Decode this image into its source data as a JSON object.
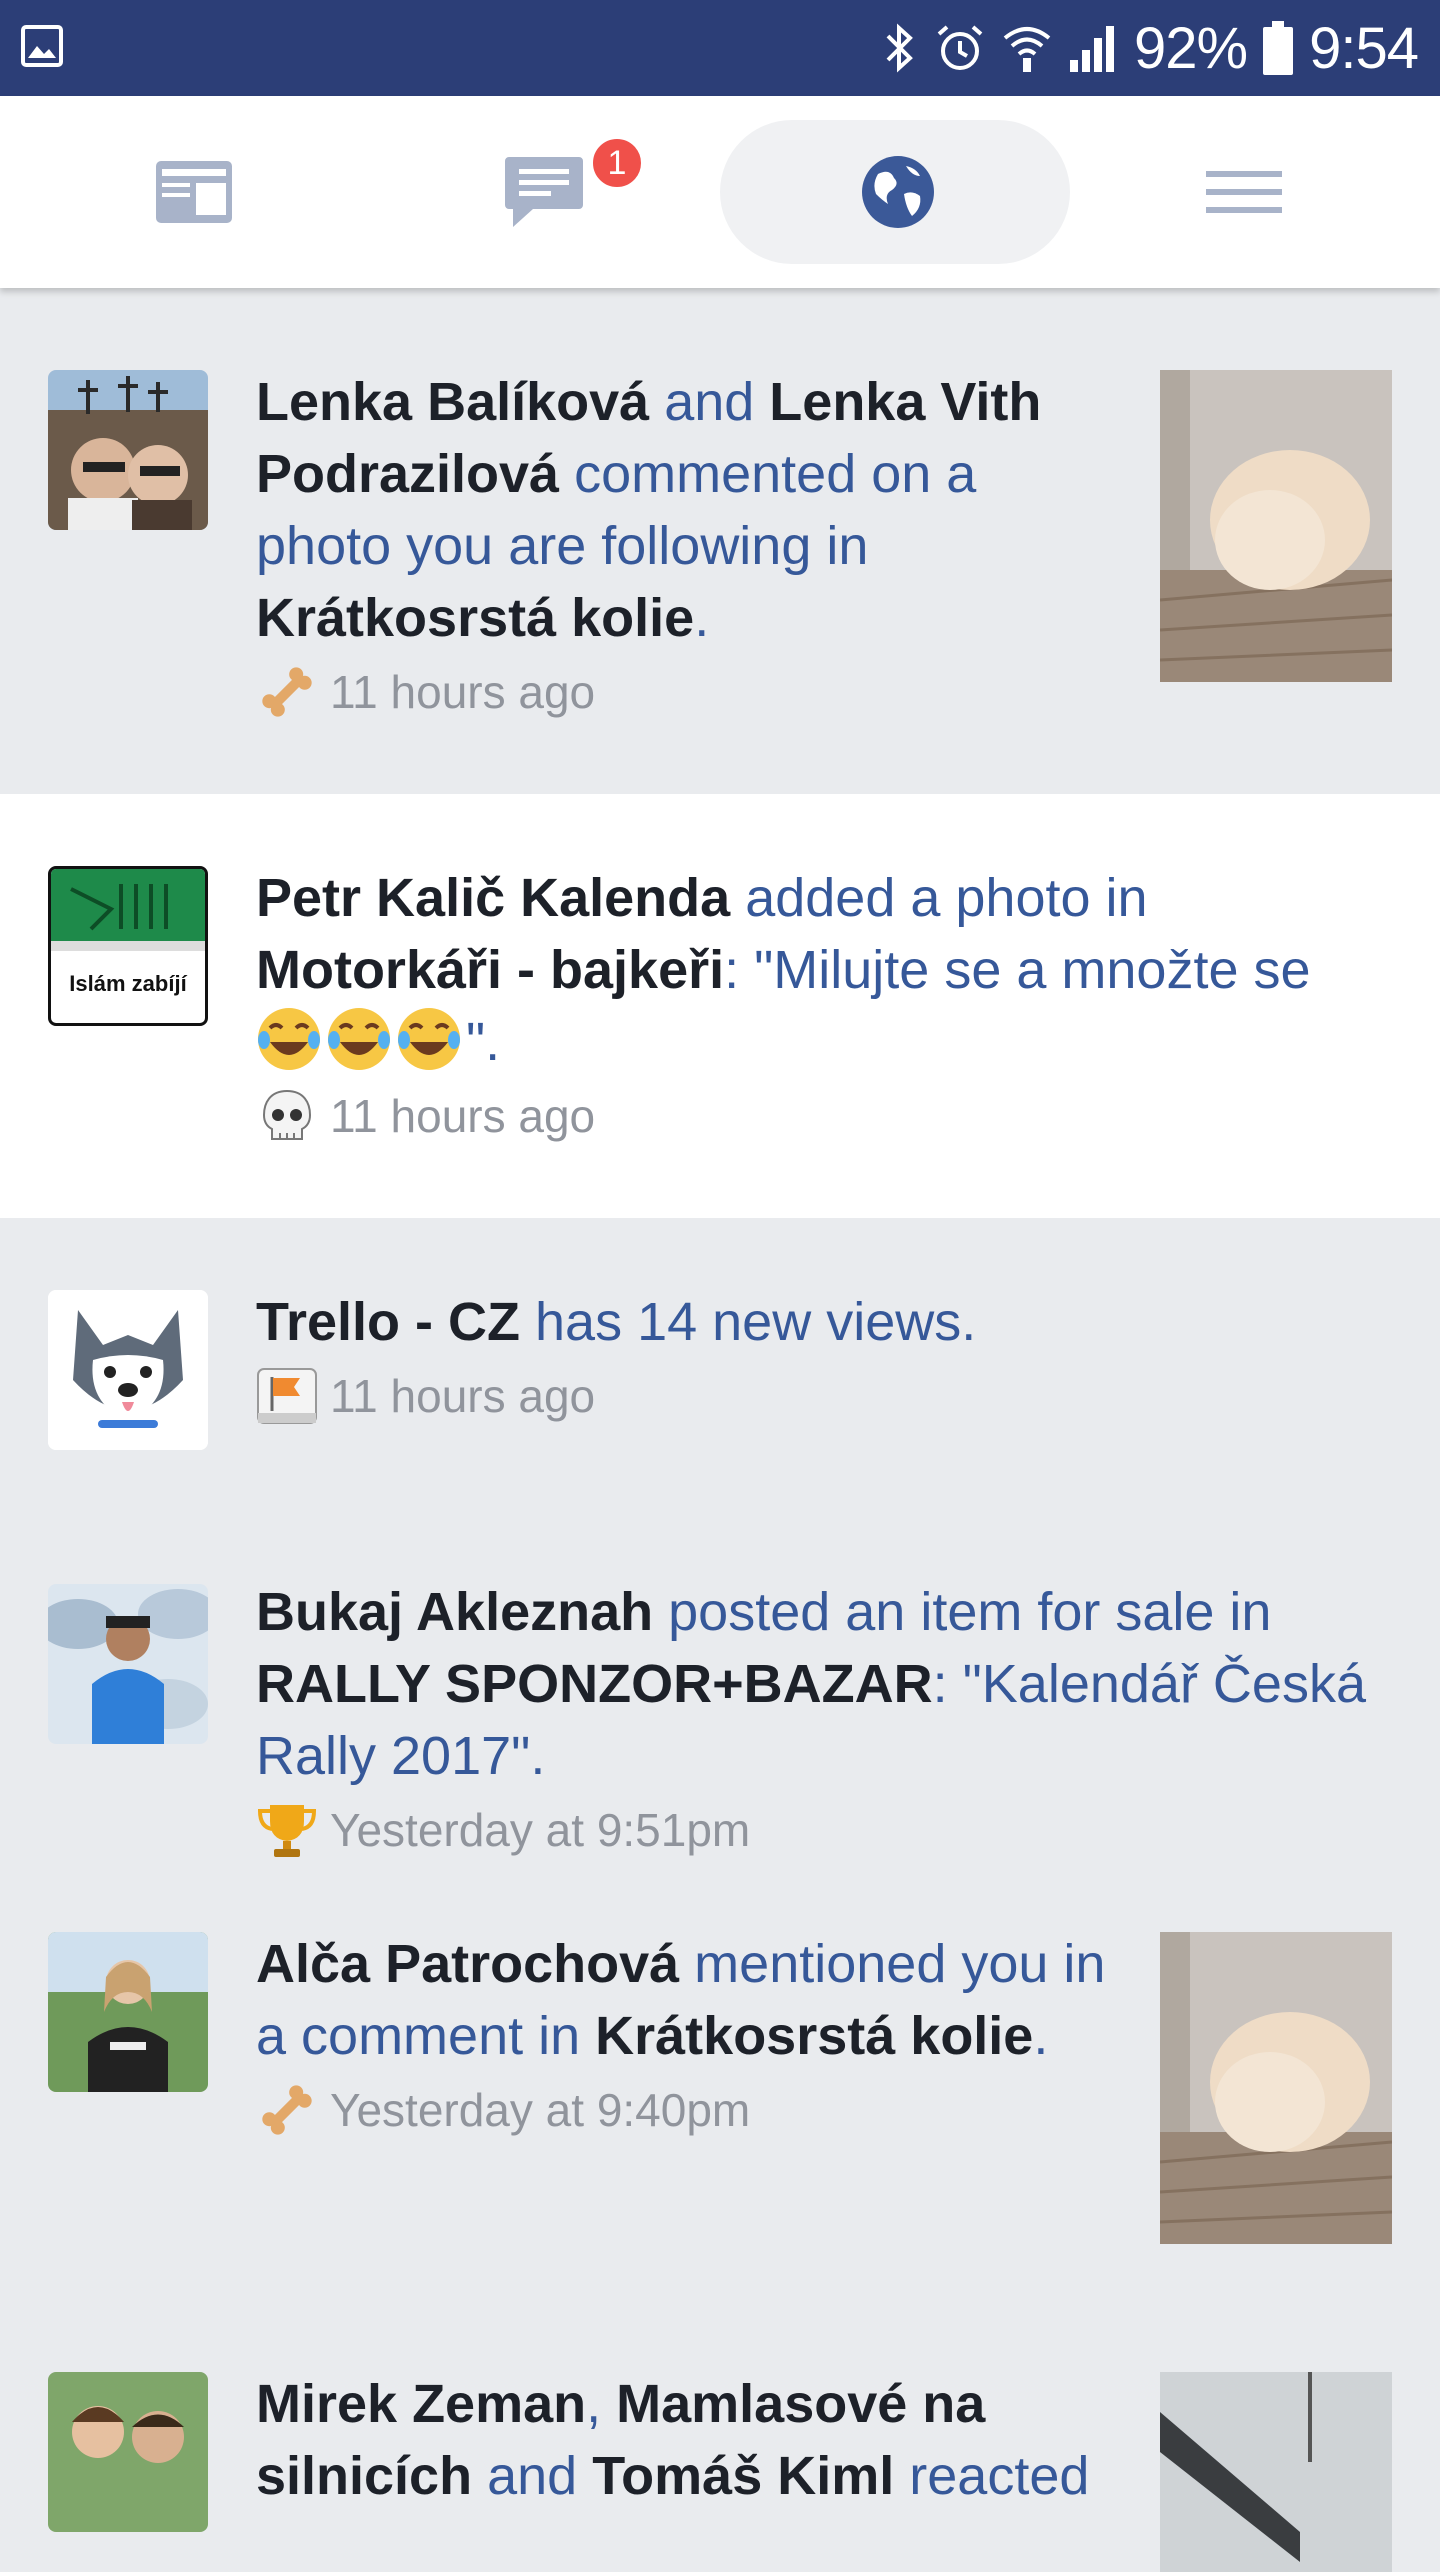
{
  "status_bar": {
    "battery": "92%",
    "time": "9:54"
  },
  "nav": {
    "tabs": [
      {
        "name": "news-feed",
        "icon": "newsfeed-icon"
      },
      {
        "name": "messages",
        "icon": "chat-icon",
        "badge": "1"
      },
      {
        "name": "notifications",
        "icon": "globe-icon",
        "active": true
      },
      {
        "name": "menu",
        "icon": "hamburger-icon"
      }
    ]
  },
  "notifications": [
    {
      "actor1": "Lenka Balíková",
      "conj": " and ",
      "actor2": "Lenka Vith Podrazilová",
      "action": " commented on a photo you are following in ",
      "target": "Krátkosrstá kolie",
      "end": ".",
      "time": "11 hours ago",
      "icon": "bone-icon"
    },
    {
      "actor1": "Petr Kalič Kalenda",
      "action": " added a photo in ",
      "target": "Motorkáři - bajkeři",
      "quote_prefix": ": \"Milujte se a množte se",
      "quote_suffix": "\".",
      "time": "11 hours ago",
      "icon": "skull-icon",
      "avatar_text": "Islám zabíjí"
    },
    {
      "actor1": "Trello - CZ",
      "action": " has 14 new views.",
      "time": "11 hours ago",
      "icon": "flag-icon"
    },
    {
      "actor1": "Bukaj Akleznah",
      "action": " posted an item for sale in ",
      "target": "RALLY SPONZOR+BAZAR",
      "quote": ": \"Kalendář Česká Rally 2017\".",
      "time": "Yesterday at 9:51pm",
      "icon": "trophy-icon"
    },
    {
      "actor1": "Alča Patrochová",
      "action": " mentioned you in a comment in ",
      "target": "Krátkosrstá kolie",
      "end": ".",
      "time": "Yesterday at 9:40pm",
      "icon": "bone-icon"
    },
    {
      "actor1": "Mirek Zeman",
      "sep": ", ",
      "actor2": "Mamlasové na silnicích",
      "conj": " and ",
      "actor3": "Tomáš Kiml",
      "action": " reacted"
    }
  ],
  "colors": {
    "status_bar": "#2c3e77",
    "link_blue": "#365899",
    "name_black": "#1d2129",
    "time_gray": "#90949c",
    "badge_red": "#f0504a",
    "unread_bg": "#e9ebee",
    "read_bg": "#ffffff"
  }
}
